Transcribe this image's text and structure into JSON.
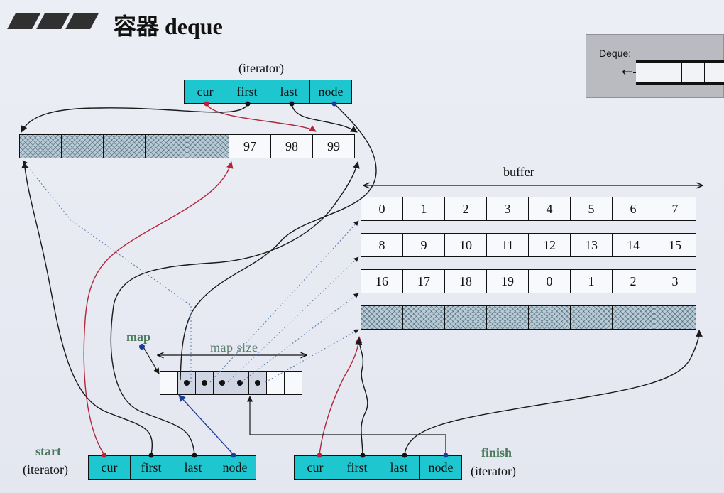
{
  "title": "容器 deque",
  "thumbnail": {
    "label": "Deque:",
    "arrow": "←--"
  },
  "iterator_label": "(iterator)",
  "top_iterator": {
    "fields": [
      "cur",
      "first",
      "last",
      "node"
    ]
  },
  "start_iterator": {
    "name": "start",
    "type": "(iterator)",
    "fields": [
      "cur",
      "first",
      "last",
      "node"
    ]
  },
  "finish_iterator": {
    "name": "finish",
    "type": "(iterator)",
    "fields": [
      "cur",
      "first",
      "last",
      "node"
    ]
  },
  "top_buffer": [
    "",
    "",
    "",
    "",
    "",
    "97",
    "98",
    "99"
  ],
  "buffer_label": "buffer",
  "buffers": [
    [
      "0",
      "1",
      "2",
      "3",
      "4",
      "5",
      "6",
      "7"
    ],
    [
      "8",
      "9",
      "10",
      "11",
      "12",
      "13",
      "14",
      "15"
    ],
    [
      "16",
      "17",
      "18",
      "19",
      "0",
      "1",
      "2",
      "3"
    ],
    [
      "",
      "",
      "",
      "",
      "",
      "",
      "",
      ""
    ]
  ],
  "map_label": "map",
  "map_size_label": "map  size",
  "colors": {
    "iterator_fill": "#1ec6cf",
    "red_pointer": "#c0392b",
    "blue_pointer": "#1f3b99",
    "label_green": "#4a7a5c"
  }
}
